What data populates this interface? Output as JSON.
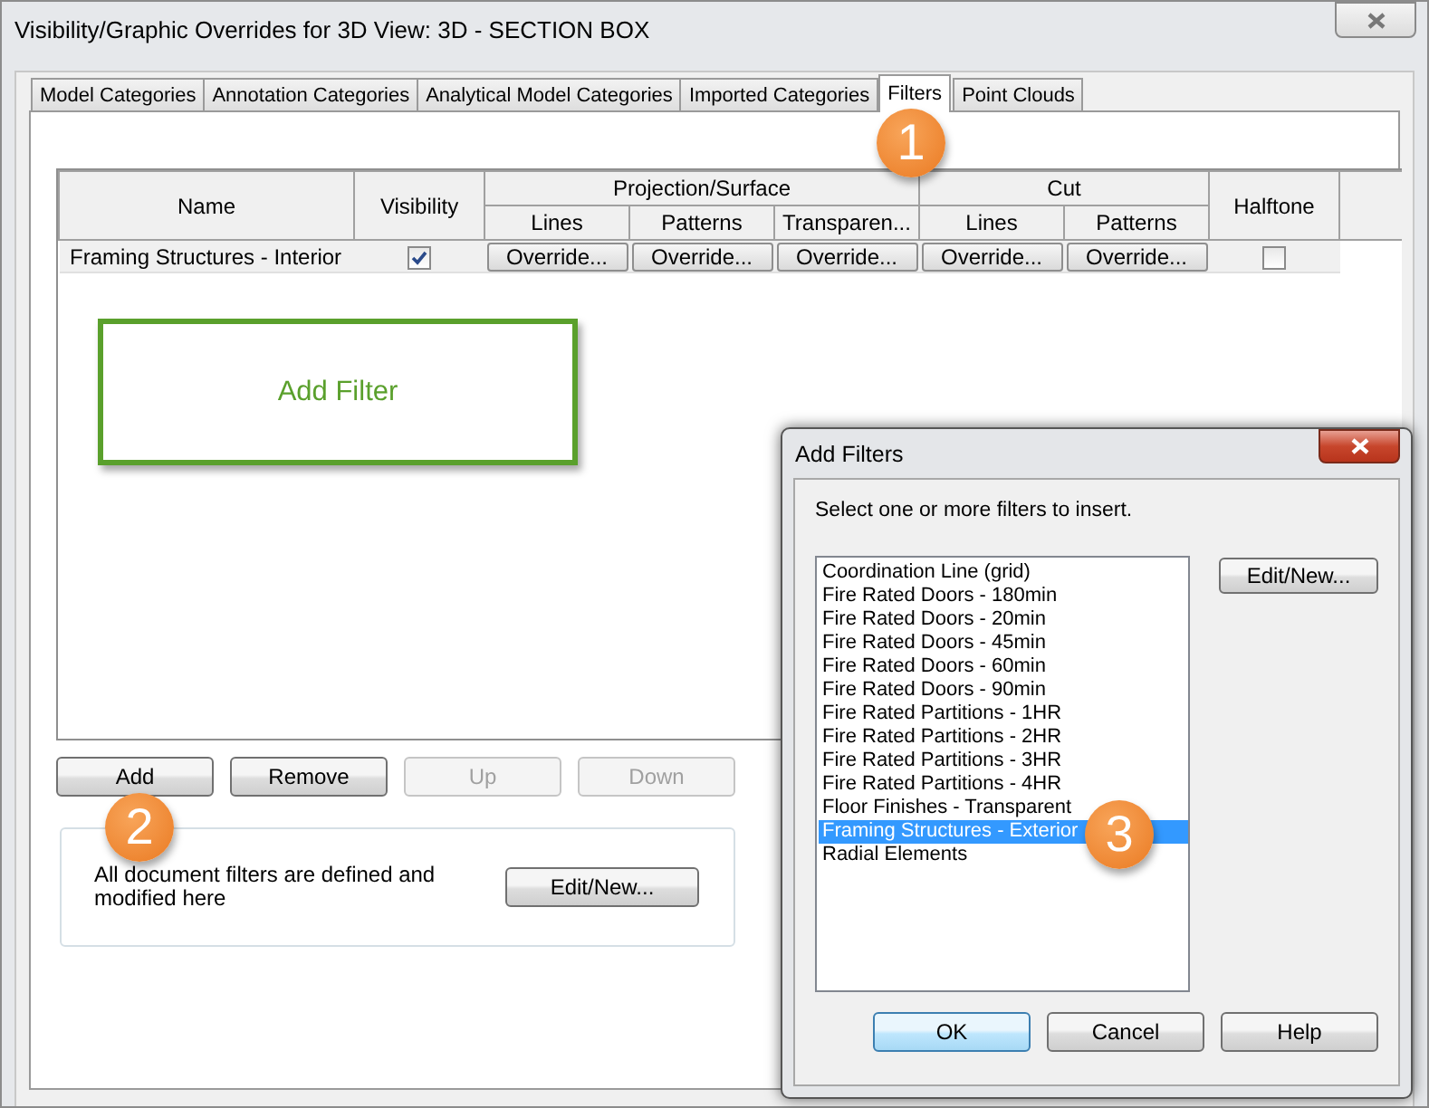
{
  "window": {
    "title": "Visibility/Graphic Overrides for 3D View: 3D - SECTION BOX"
  },
  "tabs": [
    {
      "label": "Model Categories",
      "selected": false
    },
    {
      "label": "Annotation Categories",
      "selected": false
    },
    {
      "label": "Analytical Model Categories",
      "selected": false
    },
    {
      "label": "Imported Categories",
      "selected": false
    },
    {
      "label": "Filters",
      "selected": true
    },
    {
      "label": "Point Clouds",
      "selected": false
    }
  ],
  "filters_table": {
    "header": {
      "name": "Name",
      "visibility": "Visibility",
      "projection_surface": {
        "title": "Projection/Surface",
        "columns": [
          "Lines",
          "Patterns",
          "Transparen..."
        ]
      },
      "cut": {
        "title": "Cut",
        "columns": [
          "Lines",
          "Patterns"
        ]
      },
      "halftone": "Halftone"
    },
    "rows": [
      {
        "name": "Framing Structures - Interior",
        "visible": true,
        "overrides": [
          "Override...",
          "Override...",
          "Override...",
          "Override...",
          "Override..."
        ],
        "halftone": false
      }
    ]
  },
  "buttons": [
    {
      "label": "Add",
      "disabled": false
    },
    {
      "label": "Remove",
      "disabled": false
    },
    {
      "label": "Up",
      "disabled": true
    },
    {
      "label": "Down",
      "disabled": true
    }
  ],
  "info": {
    "text": "All document filters are defined and modified here",
    "button": "Edit/New..."
  },
  "annotation": {
    "text": "Add Filter"
  },
  "dialog": {
    "title": "Add Filters",
    "prompt": "Select one or more filters to insert.",
    "items": [
      {
        "label": "Coordination Line (grid)",
        "selected": false
      },
      {
        "label": "Fire Rated Doors - 180min",
        "selected": false
      },
      {
        "label": "Fire Rated Doors - 20min",
        "selected": false
      },
      {
        "label": "Fire Rated Doors - 45min",
        "selected": false
      },
      {
        "label": "Fire Rated Doors - 60min",
        "selected": false
      },
      {
        "label": "Fire Rated Doors - 90min",
        "selected": false
      },
      {
        "label": "Fire Rated Partitions - 1HR",
        "selected": false
      },
      {
        "label": "Fire Rated Partitions - 2HR",
        "selected": false
      },
      {
        "label": "Fire Rated Partitions - 3HR",
        "selected": false
      },
      {
        "label": "Fire Rated Partitions - 4HR",
        "selected": false
      },
      {
        "label": "Floor Finishes - Transparent",
        "selected": false
      },
      {
        "label": "Framing Structures - Exterior",
        "selected": true
      },
      {
        "label": "Radial Elements",
        "selected": false
      }
    ],
    "side_button": "Edit/New...",
    "buttons": [
      {
        "label": "OK",
        "default": true
      },
      {
        "label": "Cancel",
        "default": false
      },
      {
        "label": "Help",
        "default": false
      }
    ]
  },
  "callouts": [
    "1",
    "2",
    "3"
  ]
}
